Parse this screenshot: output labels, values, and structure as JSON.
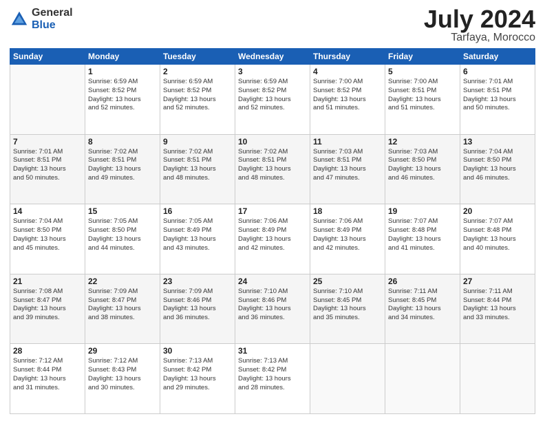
{
  "header": {
    "logo_general": "General",
    "logo_blue": "Blue",
    "title": "July 2024",
    "subtitle": "Tarfaya, Morocco"
  },
  "weekdays": [
    "Sunday",
    "Monday",
    "Tuesday",
    "Wednesday",
    "Thursday",
    "Friday",
    "Saturday"
  ],
  "weeks": [
    [
      {
        "day": "",
        "info": ""
      },
      {
        "day": "1",
        "info": "Sunrise: 6:59 AM\nSunset: 8:52 PM\nDaylight: 13 hours\nand 52 minutes."
      },
      {
        "day": "2",
        "info": "Sunrise: 6:59 AM\nSunset: 8:52 PM\nDaylight: 13 hours\nand 52 minutes."
      },
      {
        "day": "3",
        "info": "Sunrise: 6:59 AM\nSunset: 8:52 PM\nDaylight: 13 hours\nand 52 minutes."
      },
      {
        "day": "4",
        "info": "Sunrise: 7:00 AM\nSunset: 8:52 PM\nDaylight: 13 hours\nand 51 minutes."
      },
      {
        "day": "5",
        "info": "Sunrise: 7:00 AM\nSunset: 8:51 PM\nDaylight: 13 hours\nand 51 minutes."
      },
      {
        "day": "6",
        "info": "Sunrise: 7:01 AM\nSunset: 8:51 PM\nDaylight: 13 hours\nand 50 minutes."
      }
    ],
    [
      {
        "day": "7",
        "info": "Sunrise: 7:01 AM\nSunset: 8:51 PM\nDaylight: 13 hours\nand 50 minutes."
      },
      {
        "day": "8",
        "info": "Sunrise: 7:02 AM\nSunset: 8:51 PM\nDaylight: 13 hours\nand 49 minutes."
      },
      {
        "day": "9",
        "info": "Sunrise: 7:02 AM\nSunset: 8:51 PM\nDaylight: 13 hours\nand 48 minutes."
      },
      {
        "day": "10",
        "info": "Sunrise: 7:02 AM\nSunset: 8:51 PM\nDaylight: 13 hours\nand 48 minutes."
      },
      {
        "day": "11",
        "info": "Sunrise: 7:03 AM\nSunset: 8:51 PM\nDaylight: 13 hours\nand 47 minutes."
      },
      {
        "day": "12",
        "info": "Sunrise: 7:03 AM\nSunset: 8:50 PM\nDaylight: 13 hours\nand 46 minutes."
      },
      {
        "day": "13",
        "info": "Sunrise: 7:04 AM\nSunset: 8:50 PM\nDaylight: 13 hours\nand 46 minutes."
      }
    ],
    [
      {
        "day": "14",
        "info": "Sunrise: 7:04 AM\nSunset: 8:50 PM\nDaylight: 13 hours\nand 45 minutes."
      },
      {
        "day": "15",
        "info": "Sunrise: 7:05 AM\nSunset: 8:50 PM\nDaylight: 13 hours\nand 44 minutes."
      },
      {
        "day": "16",
        "info": "Sunrise: 7:05 AM\nSunset: 8:49 PM\nDaylight: 13 hours\nand 43 minutes."
      },
      {
        "day": "17",
        "info": "Sunrise: 7:06 AM\nSunset: 8:49 PM\nDaylight: 13 hours\nand 42 minutes."
      },
      {
        "day": "18",
        "info": "Sunrise: 7:06 AM\nSunset: 8:49 PM\nDaylight: 13 hours\nand 42 minutes."
      },
      {
        "day": "19",
        "info": "Sunrise: 7:07 AM\nSunset: 8:48 PM\nDaylight: 13 hours\nand 41 minutes."
      },
      {
        "day": "20",
        "info": "Sunrise: 7:07 AM\nSunset: 8:48 PM\nDaylight: 13 hours\nand 40 minutes."
      }
    ],
    [
      {
        "day": "21",
        "info": "Sunrise: 7:08 AM\nSunset: 8:47 PM\nDaylight: 13 hours\nand 39 minutes."
      },
      {
        "day": "22",
        "info": "Sunrise: 7:09 AM\nSunset: 8:47 PM\nDaylight: 13 hours\nand 38 minutes."
      },
      {
        "day": "23",
        "info": "Sunrise: 7:09 AM\nSunset: 8:46 PM\nDaylight: 13 hours\nand 36 minutes."
      },
      {
        "day": "24",
        "info": "Sunrise: 7:10 AM\nSunset: 8:46 PM\nDaylight: 13 hours\nand 36 minutes."
      },
      {
        "day": "25",
        "info": "Sunrise: 7:10 AM\nSunset: 8:45 PM\nDaylight: 13 hours\nand 35 minutes."
      },
      {
        "day": "26",
        "info": "Sunrise: 7:11 AM\nSunset: 8:45 PM\nDaylight: 13 hours\nand 34 minutes."
      },
      {
        "day": "27",
        "info": "Sunrise: 7:11 AM\nSunset: 8:44 PM\nDaylight: 13 hours\nand 33 minutes."
      }
    ],
    [
      {
        "day": "28",
        "info": "Sunrise: 7:12 AM\nSunset: 8:44 PM\nDaylight: 13 hours\nand 31 minutes."
      },
      {
        "day": "29",
        "info": "Sunrise: 7:12 AM\nSunset: 8:43 PM\nDaylight: 13 hours\nand 30 minutes."
      },
      {
        "day": "30",
        "info": "Sunrise: 7:13 AM\nSunset: 8:42 PM\nDaylight: 13 hours\nand 29 minutes."
      },
      {
        "day": "31",
        "info": "Sunrise: 7:13 AM\nSunset: 8:42 PM\nDaylight: 13 hours\nand 28 minutes."
      },
      {
        "day": "",
        "info": ""
      },
      {
        "day": "",
        "info": ""
      },
      {
        "day": "",
        "info": ""
      }
    ]
  ]
}
